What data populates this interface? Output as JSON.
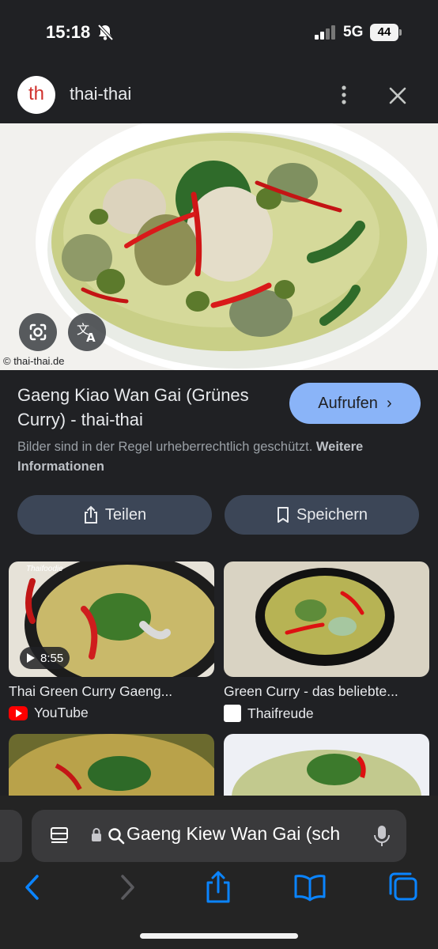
{
  "status_bar": {
    "time": "15:18",
    "network": "5G",
    "battery": "44"
  },
  "header": {
    "logo_text": "th",
    "site_name": "thai-thai"
  },
  "image": {
    "copyright": "© thai-thai.de"
  },
  "result": {
    "title": "Gaeng Kiao Wan Gai (Grünes Curry) - thai-thai",
    "visit_label": "Aufrufen",
    "notice_text": "Bilder sind in der Regel urheberrechtlich geschützt.",
    "notice_link": "Weitere Informationen",
    "share_label": "Teilen",
    "save_label": "Speichern"
  },
  "related": [
    {
      "title": "Thai Green Curry Gaeng...",
      "source": "YouTube",
      "duration": "8:55",
      "thumb_overlay": "Thaifoodie"
    },
    {
      "title": "Green Curry - das beliebte...",
      "source": "Thaifreude"
    }
  ],
  "browser": {
    "url": "Gaeng Kiew Wan Gai (sch"
  },
  "colors": {
    "accent": "#8ab4f8",
    "background": "#202124",
    "pill": "#3c4657",
    "ios_blue": "#0a84ff"
  },
  "icons": [
    "bell-slash-icon",
    "signal-icon",
    "more-vert-icon",
    "close-icon",
    "google-lens-icon",
    "translate-icon",
    "share-icon",
    "bookmark-icon",
    "reader-icon",
    "lock-icon",
    "search-icon",
    "mic-icon",
    "back-icon",
    "forward-icon",
    "safari-share-icon",
    "bookmarks-icon",
    "tabs-icon"
  ]
}
